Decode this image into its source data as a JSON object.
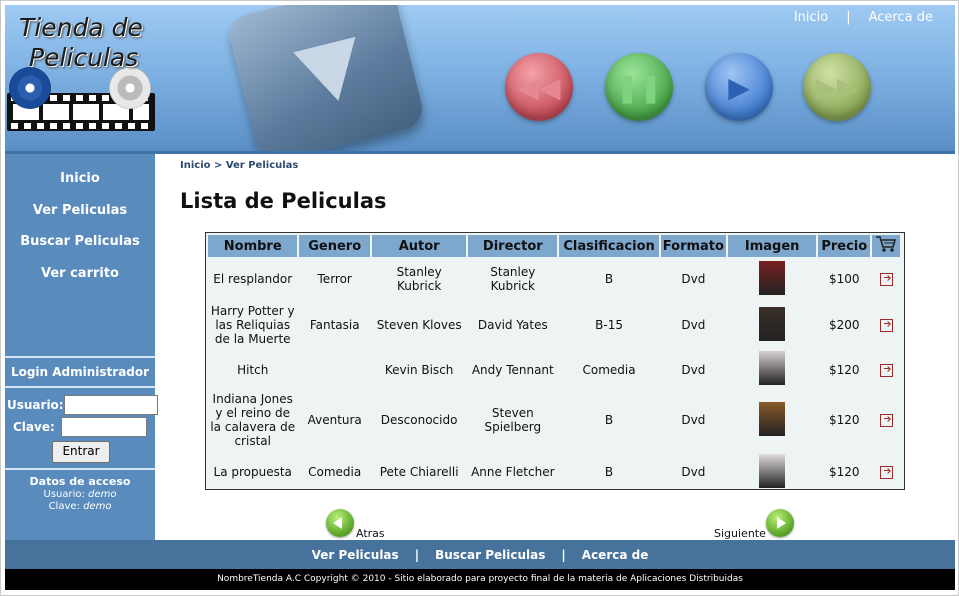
{
  "header": {
    "logo_line1": "Tienda de",
    "logo_line2": "Peliculas",
    "nav": [
      "Inicio",
      "Acerca de"
    ]
  },
  "sidebar": {
    "menu": [
      "Inicio",
      "Ver Peliculas",
      "Buscar Peliculas",
      "Ver carrito"
    ],
    "login_title": "Login Administrador",
    "user_label": "Usuario:",
    "pass_label": "Clave:",
    "submit": "Entrar",
    "access_title": "Datos de acceso",
    "access_user_label": "Usuario:",
    "access_user": "demo",
    "access_pass_label": "Clave:",
    "access_pass": "demo"
  },
  "breadcrumb": "Inicio > Ver Peliculas",
  "page_title": "Lista de Peliculas",
  "table": {
    "headers": [
      "Nombre",
      "Genero",
      "Autor",
      "Director",
      "Clasificacion",
      "Formato",
      "Imagen",
      "Precio"
    ],
    "cart_icon": "cart-icon",
    "rows": [
      {
        "nombre": "El resplandor",
        "genero": "Terror",
        "autor": "Stanley Kubrick",
        "director": "Stanley Kubrick",
        "clasificacion": "B",
        "formato": "Dvd",
        "precio": "$100",
        "poster_color": "#7a2020"
      },
      {
        "nombre": "Harry Potter y las Reliquias de la Muerte",
        "genero": "Fantasia",
        "autor": "Steven Kloves",
        "director": "David Yates",
        "clasificacion": "B-15",
        "formato": "Dvd",
        "precio": "$200",
        "poster_color": "#3a3028"
      },
      {
        "nombre": "Hitch",
        "genero": "",
        "autor": "Kevin Bisch",
        "director": "Andy Tennant",
        "clasificacion": "Comedia",
        "formato": "Dvd",
        "precio": "$120",
        "poster_color": "#d8d0d0"
      },
      {
        "nombre": "Indiana Jones y el reino de la calavera de cristal",
        "genero": "Aventura",
        "autor": "Desconocido",
        "director": "Steven Spielberg",
        "clasificacion": "B",
        "formato": "Dvd",
        "precio": "$120",
        "poster_color": "#8a5a2a"
      },
      {
        "nombre": "La propuesta",
        "genero": "Comedia",
        "autor": "Pete Chiarelli",
        "director": "Anne Fletcher",
        "clasificacion": "B",
        "formato": "Dvd",
        "precio": "$120",
        "poster_color": "#e0dcdc"
      }
    ]
  },
  "pager": {
    "prev": "Atras",
    "next": "Siguiente"
  },
  "footer": {
    "links": [
      "Ver Peliculas",
      "Buscar Peliculas",
      "Acerca de"
    ],
    "copyright": "NombreTienda A.C Copyright © 2010 - Sitio elaborado para proyecto final de la materia de Aplicaciones Distribuidas"
  }
}
